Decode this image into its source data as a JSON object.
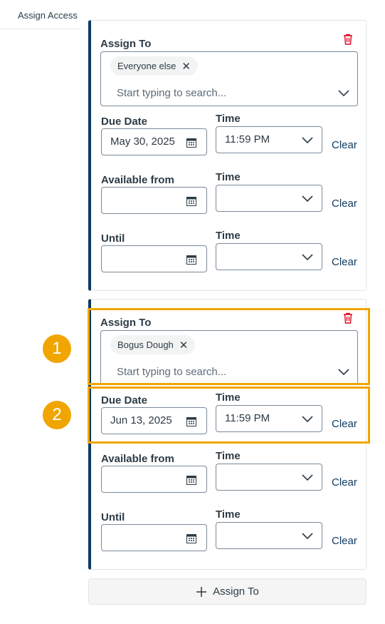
{
  "sidebar": {
    "tab_label": "Assign Access"
  },
  "cards": [
    {
      "assign_label": "Assign To",
      "chip": "Everyone else",
      "search_placeholder": "Start typing to search...",
      "due_label": "Due Date",
      "due_value": "May 30, 2025",
      "time_label": "Time",
      "due_time": "11:59 PM",
      "available_label": "Available from",
      "available_value": "",
      "available_time": "",
      "until_label": "Until",
      "until_value": "",
      "until_time": "",
      "clear_label": "Clear"
    },
    {
      "assign_label": "Assign To",
      "chip": "Bogus Dough",
      "search_placeholder": "Start typing to search...",
      "due_label": "Due Date",
      "due_value": "Jun 13, 2025",
      "time_label": "Time",
      "due_time": "11:59 PM",
      "available_label": "Available from",
      "available_value": "",
      "available_time": "",
      "until_label": "Until",
      "until_value": "",
      "until_time": "",
      "clear_label": "Clear"
    }
  ],
  "callouts": [
    "1",
    "2"
  ],
  "add_button": {
    "label": "Assign To"
  },
  "colors": {
    "accent": "#0e3a5f",
    "highlight": "#f0a500",
    "trash": "#e0061f"
  }
}
